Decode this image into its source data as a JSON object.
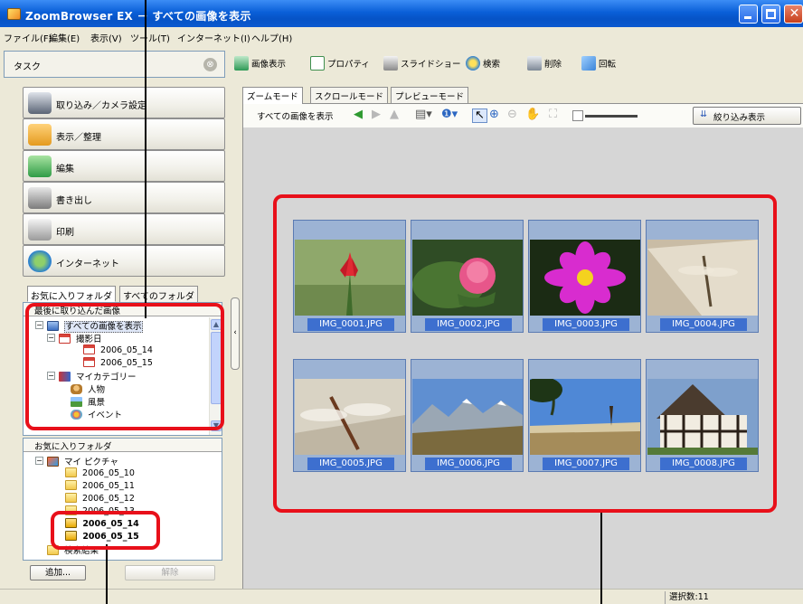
{
  "window": {
    "title": "ZoomBrowser EX － すべての画像を表示"
  },
  "menu": [
    "ファイル(F)",
    "編集(E)",
    "表示(V)",
    "ツール(T)",
    "インターネット(I)",
    "ヘルプ(H)"
  ],
  "left": {
    "task_label": "タスク",
    "task_collapse_glyph": "⊗",
    "tasks": [
      {
        "label": "取り込み／カメラ設定",
        "icon": "camera-icon",
        "color": "#5a6475"
      },
      {
        "label": "表示／整理",
        "icon": "folder-icon",
        "color": "#e49a1f"
      },
      {
        "label": "編集",
        "icon": "edit-photo-icon",
        "color": "#2f9c46"
      },
      {
        "label": "書き出し",
        "icon": "export-icon",
        "color": "#7c7c7c"
      },
      {
        "label": "印刷",
        "icon": "printer-icon",
        "color": "#9a9a9a"
      },
      {
        "label": "インターネット",
        "icon": "internet-globe-icon",
        "color": "#2a7fd1"
      }
    ],
    "folder_tabs": [
      "お気に入りフォルダ",
      "すべてのフォルダ"
    ],
    "recent": {
      "header": "最後に取り込んだ画像",
      "items": [
        {
          "label": "すべての画像を表示",
          "icon": "comp",
          "level": 0,
          "toggle": "−",
          "selected": true
        },
        {
          "label": "撮影日",
          "icon": "cal",
          "level": 1,
          "toggle": "−"
        },
        {
          "label": "2006_05_14",
          "icon": "cal",
          "level": 2
        },
        {
          "label": "2006_05_15",
          "icon": "cal",
          "level": 2
        },
        {
          "label": "マイカテゴリー",
          "icon": "cat",
          "level": 1,
          "toggle": "−"
        },
        {
          "label": "人物",
          "icon": "ppl",
          "level": 2
        },
        {
          "label": "風景",
          "icon": "land",
          "level": 2
        },
        {
          "label": "イベント",
          "icon": "evt",
          "level": 2
        }
      ]
    },
    "favorites": {
      "header": "お気に入りフォルダ",
      "items": [
        {
          "label": "マイ ピクチャ",
          "icon": "pic",
          "level": 0,
          "toggle": "−"
        },
        {
          "label": "2006_05_10",
          "icon": "fold",
          "level": 1
        },
        {
          "label": "2006_05_11",
          "icon": "fold",
          "level": 1
        },
        {
          "label": "2006_05_12",
          "icon": "fold",
          "level": 1
        },
        {
          "label": "2006_05_13",
          "icon": "fold",
          "level": 1
        },
        {
          "label": "2006_05_14",
          "icon": "imp",
          "level": 1,
          "bold": true
        },
        {
          "label": "2006_05_15",
          "icon": "imp",
          "level": 1,
          "bold": true
        },
        {
          "label": "検索結果",
          "icon": "fold",
          "level": 0
        }
      ]
    },
    "add_label": "追加...",
    "remove_label": "解除"
  },
  "toolbar": [
    {
      "label": "画像表示",
      "icon": "image-view-icon",
      "color": "#2e9a56"
    },
    {
      "label": "プロパティ",
      "icon": "properties-icon",
      "color": "#3f8f4f"
    },
    {
      "label": "スライドショー",
      "icon": "slideshow-icon",
      "color": "#8a8a8a"
    },
    {
      "label": "検索",
      "icon": "search-icon",
      "color": "#2b7fd6"
    },
    {
      "label": "削除",
      "icon": "trash-icon",
      "color": "#7d8896"
    },
    {
      "label": "回転",
      "icon": "rotate-icon",
      "color": "#3b84d8"
    }
  ],
  "view_tabs": [
    "ズームモード",
    "スクロールモード",
    "プレビューモード"
  ],
  "subtoolbar": {
    "title": "すべての画像を表示",
    "filter_label": "絞り込み表示"
  },
  "thumbnails": [
    {
      "name": "IMG_0001.JPG",
      "scene": "flower-red"
    },
    {
      "name": "IMG_0002.JPG",
      "scene": "rose-bud"
    },
    {
      "name": "IMG_0003.JPG",
      "scene": "cosmos"
    },
    {
      "name": "IMG_0004.JPG",
      "scene": "dragonfly-wood"
    },
    {
      "name": "IMG_0005.JPG",
      "scene": "dragonfly-close"
    },
    {
      "name": "IMG_0006.JPG",
      "scene": "mountains"
    },
    {
      "name": "IMG_0007.JPG",
      "scene": "coast-tree"
    },
    {
      "name": "IMG_0008.JPG",
      "scene": "tudor-house"
    }
  ],
  "status": {
    "selected_count": "選択数:11"
  },
  "colors": {
    "accent": "#0a5fd8",
    "annotation": "#e8101a",
    "selection": "#3d6fcf"
  }
}
